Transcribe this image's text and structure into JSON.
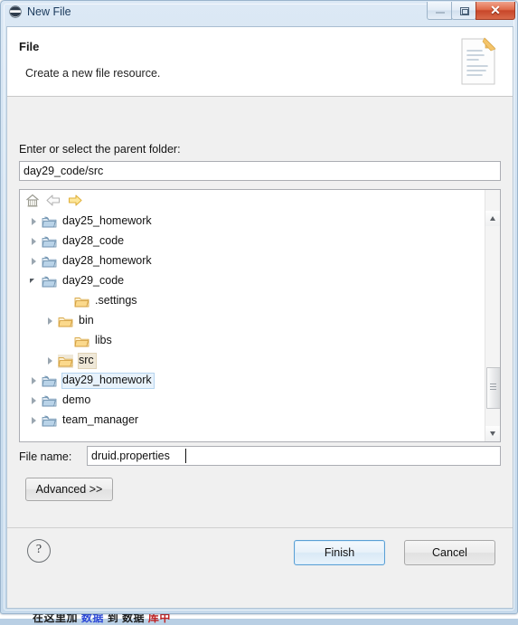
{
  "window": {
    "title": "New File",
    "app_icon": "eclipse-icon",
    "controls": {
      "minimize": "minimize",
      "restore": "restore",
      "close": "close"
    }
  },
  "banner": {
    "title": "File",
    "description": "Create a new file resource.",
    "icon": "new-file-document-icon"
  },
  "parent_folder": {
    "label": "Enter or select the parent folder:",
    "value": "day29_code/src",
    "placeholder": ""
  },
  "tree_toolbar": {
    "home": "home-icon",
    "back": "back-arrow-icon",
    "forward": "forward-arrow-icon"
  },
  "tree": {
    "items": [
      {
        "label": "day25_homework",
        "indent": 0,
        "twisty": "collapsed",
        "icon": "project-folder-icon",
        "state": "normal"
      },
      {
        "label": "day28_code",
        "indent": 0,
        "twisty": "collapsed",
        "icon": "project-folder-icon",
        "state": "normal"
      },
      {
        "label": "day28_homework",
        "indent": 0,
        "twisty": "collapsed",
        "icon": "project-folder-icon",
        "state": "normal"
      },
      {
        "label": "day29_code",
        "indent": 0,
        "twisty": "expanded",
        "icon": "project-folder-icon",
        "state": "normal"
      },
      {
        "label": ".settings",
        "indent": 2,
        "twisty": "none",
        "icon": "folder-icon",
        "state": "normal"
      },
      {
        "label": "bin",
        "indent": 1,
        "twisty": "collapsed",
        "icon": "folder-icon",
        "state": "normal"
      },
      {
        "label": "libs",
        "indent": 2,
        "twisty": "none",
        "icon": "folder-icon",
        "state": "normal"
      },
      {
        "label": "src",
        "indent": 1,
        "twisty": "collapsed",
        "icon": "folder-icon",
        "state": "selected"
      },
      {
        "label": "day29_homework",
        "indent": 0,
        "twisty": "collapsed",
        "icon": "project-folder-icon",
        "state": "hovered"
      },
      {
        "label": "demo",
        "indent": 0,
        "twisty": "collapsed",
        "icon": "project-folder-icon",
        "state": "normal"
      },
      {
        "label": "team_manager",
        "indent": 0,
        "twisty": "collapsed",
        "icon": "project-folder-icon",
        "state": "normal"
      }
    ]
  },
  "file_name": {
    "label": "File name:",
    "value": "druid.properties",
    "placeholder": ""
  },
  "advanced": {
    "label": "Advanced >>"
  },
  "footer": {
    "help": "?",
    "finish": "Finish",
    "cancel": "Cancel"
  },
  "colors": {
    "selection_bg": "#efe8d8",
    "hover_bg": "#e8f2fb",
    "default_button_border": "#5a9fd4",
    "close_button": "#c8472a",
    "folder_yellow": "#f0c067",
    "project_blue": "#8fb8d8"
  }
}
